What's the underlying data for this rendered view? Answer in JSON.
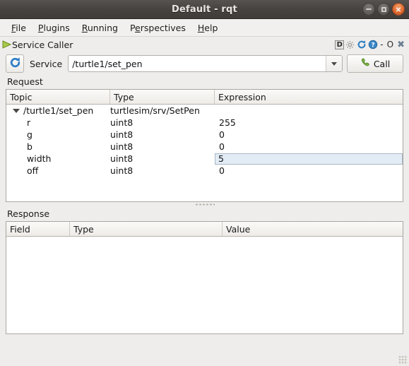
{
  "window": {
    "title": "Default - rqt",
    "controls": {
      "minimize": "−",
      "maximize": "□",
      "close": "×"
    }
  },
  "menubar": {
    "items": [
      {
        "label": "File",
        "mnemonic_index": 0
      },
      {
        "label": "Plugins",
        "mnemonic_index": 0
      },
      {
        "label": "Running",
        "mnemonic_index": 0
      },
      {
        "label": "Perspectives",
        "mnemonic_index": 1
      },
      {
        "label": "Help",
        "mnemonic_index": 0
      }
    ]
  },
  "plugin": {
    "title": "Service Caller",
    "icons": [
      {
        "name": "dock-d-icon",
        "label": "D"
      },
      {
        "name": "settings-gear-icon",
        "label": "⚙"
      },
      {
        "name": "refresh-c-icon",
        "label": "C"
      },
      {
        "name": "help-question-icon",
        "label": "?"
      }
    ],
    "dock_controls": {
      "minimize": "-",
      "float": "O",
      "close": "✖"
    }
  },
  "toolbar": {
    "refresh_icon": "refresh-icon",
    "service_label": "Service",
    "service_value": "/turtle1/set_pen",
    "service_placeholder": "/turtle1/set_pen",
    "dropdown_icon": "chevron-down-icon",
    "call_label": "Call",
    "call_icon": "phone-handset-icon"
  },
  "request": {
    "section_label": "Request",
    "columns": [
      "Topic",
      "Type",
      "Expression"
    ],
    "rows": [
      {
        "topic": "/turtle1/set_pen",
        "type": "turtlesim/srv/SetPen",
        "expression": "",
        "root": true,
        "expanded": true,
        "editing": false
      },
      {
        "topic": "r",
        "type": "uint8",
        "expression": "255",
        "root": false,
        "expanded": false,
        "editing": false
      },
      {
        "topic": "g",
        "type": "uint8",
        "expression": "0",
        "root": false,
        "expanded": false,
        "editing": false
      },
      {
        "topic": "b",
        "type": "uint8",
        "expression": "0",
        "root": false,
        "expanded": false,
        "editing": false
      },
      {
        "topic": "width",
        "type": "uint8",
        "expression": "5",
        "root": false,
        "expanded": false,
        "editing": true
      },
      {
        "topic": "off",
        "type": "uint8",
        "expression": "0",
        "root": false,
        "expanded": false,
        "editing": false
      }
    ]
  },
  "response": {
    "section_label": "Response",
    "columns": [
      "Field",
      "Type",
      "Value"
    ],
    "rows": []
  },
  "colors": {
    "titlebar": "#474341",
    "window_bg": "#efedeb",
    "close_button": "#df6b32",
    "edit_cell_bg": "#e2ecf5",
    "accent_blue": "#2a6fb5",
    "play_green": "#8fbd3a"
  }
}
